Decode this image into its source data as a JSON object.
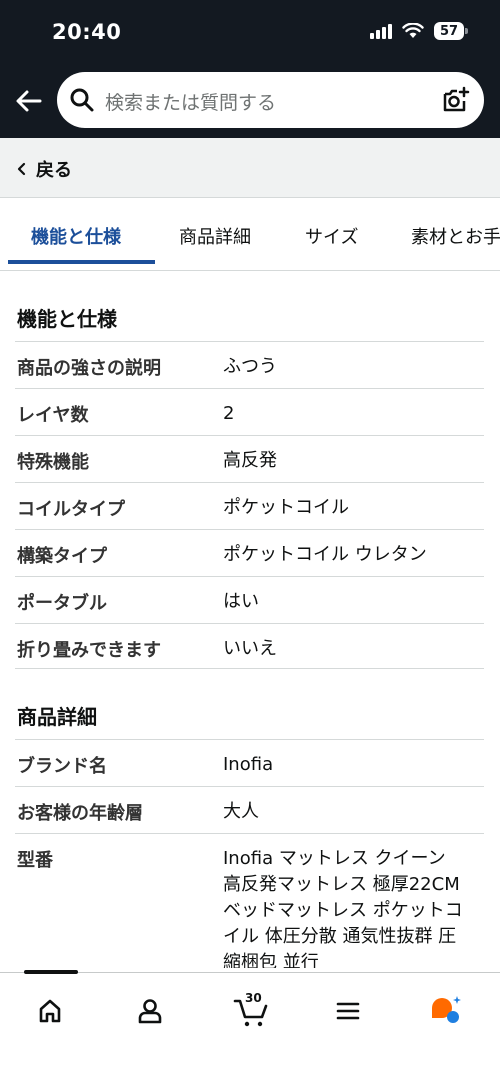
{
  "status_bar": {
    "time": "20:40",
    "battery": "57"
  },
  "search": {
    "placeholder": "検索または質問する"
  },
  "nav": {
    "back_label": "戻る"
  },
  "tabs": [
    {
      "label": "機能と仕様",
      "active": true
    },
    {
      "label": "商品詳細",
      "active": false
    },
    {
      "label": "サイズ",
      "active": false
    },
    {
      "label": "素材とお手",
      "active": false
    }
  ],
  "features": {
    "title": "機能と仕様",
    "rows": [
      {
        "label": "商品の強さの説明",
        "value": "ふつう"
      },
      {
        "label": "レイヤ数",
        "value": "2"
      },
      {
        "label": "特殊機能",
        "value": "高反発"
      },
      {
        "label": "コイルタイプ",
        "value": "ポケットコイル"
      },
      {
        "label": "構築タイプ",
        "value": "ポケットコイル ウレタン"
      },
      {
        "label": "ポータブル",
        "value": "はい"
      },
      {
        "label": "折り畳みできます",
        "value": "いいえ"
      }
    ]
  },
  "details": {
    "title": "商品詳細",
    "rows": [
      {
        "label": "ブランド名",
        "value": "Inofia"
      },
      {
        "label": "お客様の年齢層",
        "value": "大人"
      },
      {
        "label": "型番",
        "value": "Inofia マットレス クイーン 高反発マットレス 極厚22CM ベッドマットレス ポケットコイル 体圧分散 通気性抜群 圧縮梱包 並行"
      }
    ]
  },
  "bottom_nav": {
    "cart_count": "30"
  },
  "colors": {
    "header_bg": "#131921",
    "accent": "#1c4f9a",
    "rufus": "#ff6a00"
  }
}
